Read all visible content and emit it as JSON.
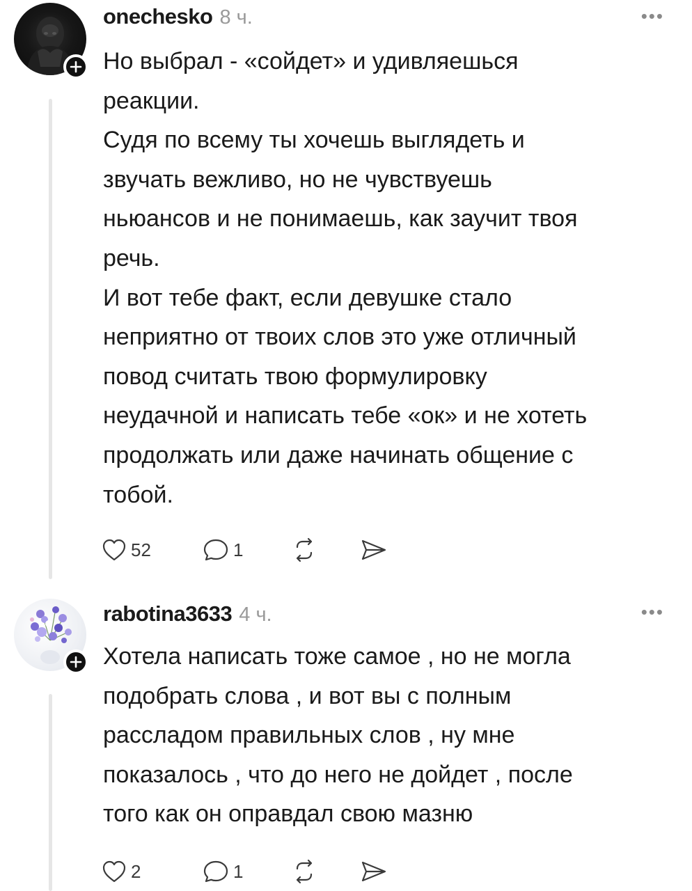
{
  "comments": [
    {
      "username": "onechesko",
      "time": "8 ч.",
      "more_icon": "more-dots-icon",
      "text": "Но выбрал - «сойдет» и удивляешься\nреакции.\nСудя по всему ты хочешь выглядеть и\nзвучать вежливо, но не чувствуешь\nньюансов и не понимаешь, как заучит твоя\nречь.\nИ вот тебе факт, если девушке стало\nнеприятно от твоих слов это уже отличный\nповод считать твою формулировку\nнеудачной и написать тебе «ок» и не хотеть\nпродолжать или даже начинать общение с\nтобой.",
      "likes": "52",
      "replies": "1"
    },
    {
      "username": "rabotina3633",
      "time": "4 ч.",
      "more_icon": "more-dots-icon",
      "text": "Хотела написать тоже самое , но не могла\nподобрать слова , и вот вы с полным\nрассладом правильных слов , ну мне\nпоказалось , что до него не дойдет , после\nтого как он оправдал свою мазню",
      "likes": "2",
      "replies": "1"
    }
  ],
  "icons": {
    "like": "heart-icon",
    "reply": "speech-bubble-icon",
    "repost": "repost-icon",
    "share": "send-icon",
    "follow": "plus-icon"
  },
  "colors": {
    "text": "#1a1a1a",
    "muted": "#9a9a9a",
    "thread_line": "#e6e6e6",
    "badge": "#111111"
  }
}
